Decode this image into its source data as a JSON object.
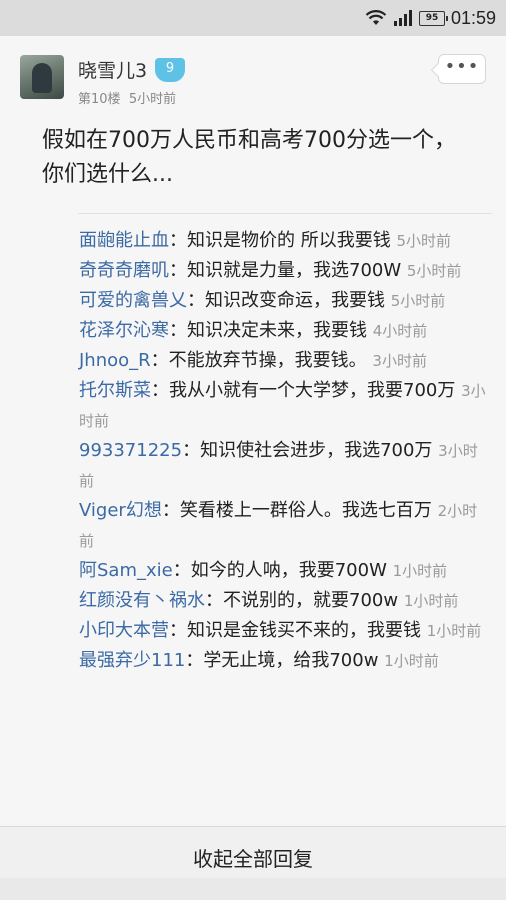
{
  "statusbar": {
    "battery": "95",
    "time": "01:59"
  },
  "post": {
    "username": "晓雪儿3",
    "level": "9",
    "floor": "第10楼",
    "posted": "5小时前",
    "text": "假如在700万人民币和高考700分选一个，你们选什么...",
    "more": "•••"
  },
  "replies": [
    {
      "name": "面龅能止血",
      "content": "知识是物价的 所以我要钱",
      "time": "5小时前"
    },
    {
      "name": "奇奇奇磨叽",
      "content": "知识就是力量，我选700W",
      "time": "5小时前"
    },
    {
      "name": "可爱的禽兽乂",
      "content": "知识改变命运，我要钱",
      "time": "5小时前"
    },
    {
      "name": "花泽尔沁寒",
      "content": "知识决定未来，我要钱",
      "time": "4小时前"
    },
    {
      "name": "Jhnoo_R",
      "content": "不能放弃节操，我要钱。",
      "time": "3小时前"
    },
    {
      "name": "托尔斯菜",
      "content": "我从小就有一个大学梦，我要700万",
      "time": "3小时前"
    },
    {
      "name": "993371225",
      "content": "知识使社会进步，我选700万",
      "time": "3小时前"
    },
    {
      "name": "Viger幻想",
      "content": "笑看楼上一群俗人。我选七百万",
      "time": "2小时前"
    },
    {
      "name": "阿Sam_xie",
      "content": "如今的人呐，我要700W",
      "time": "1小时前"
    },
    {
      "name": "红颜没有丶祸水",
      "content": "不说别的，就要700w",
      "time": "1小时前"
    },
    {
      "name": "小印大本营",
      "content": "知识是金钱买不来的，我要钱",
      "time": "1小时前"
    },
    {
      "name": "最强弃少111",
      "content": "学无止境，给我700w",
      "time": "1小时前"
    }
  ],
  "footer": {
    "collapse_label": "收起全部回复"
  }
}
